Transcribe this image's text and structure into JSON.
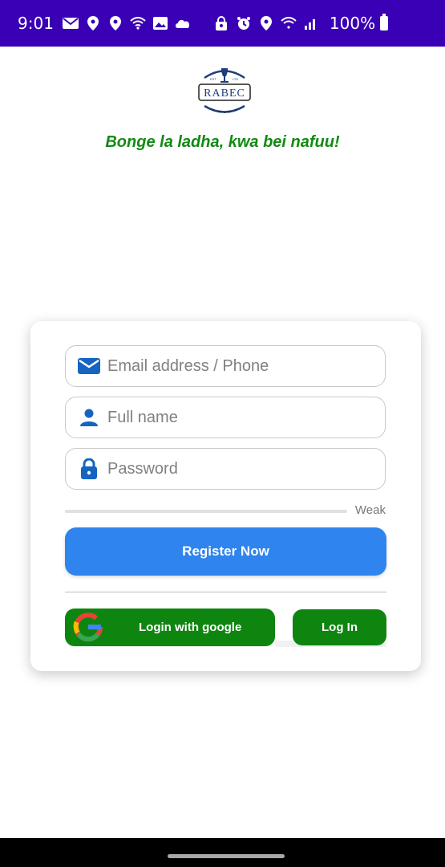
{
  "status_bar": {
    "time": "9:01",
    "battery": "100%",
    "icons_left": [
      "message-icon",
      "location-icon",
      "location-icon",
      "wifi-icon",
      "image-icon",
      "cloud-icon"
    ],
    "icons_right": [
      "lock-icon",
      "alarm-icon",
      "location-icon",
      "wifi-icon",
      "signal-icon"
    ],
    "color": "#3a00b5"
  },
  "logo": {
    "text": "RABEC",
    "small_left": "EST",
    "small_right": "LTD"
  },
  "slogan": "Bonge la ladha, kwa bei nafuu!",
  "form": {
    "email_placeholder": "Email address / Phone",
    "name_placeholder": "Full name",
    "password_placeholder": "Password",
    "strength_label": "Weak",
    "strength_value": 0,
    "register_label": "Register Now",
    "google_label": "Login with google",
    "login_label": "Log In"
  },
  "colors": {
    "accent_blue": "#2f84ee",
    "brand_green": "#0e850f",
    "slogan_green": "#138a13"
  }
}
